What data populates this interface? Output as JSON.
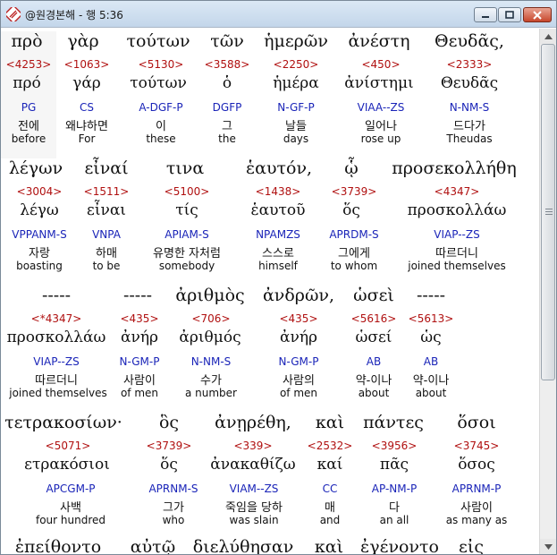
{
  "window": {
    "title": "@원경본해 - 행 5:36"
  },
  "verse": [
    {
      "greek": "πρὸ",
      "strong": "<4253>",
      "lemma": "πρό",
      "morph": "PG",
      "korean": "전에",
      "english": "before"
    },
    {
      "greek": "γὰρ",
      "strong": "<1063>",
      "lemma": "γάρ",
      "morph": "CS",
      "korean": "왜냐하면",
      "english": "For"
    },
    {
      "greek": "τούτων",
      "strong": "<5130>",
      "lemma": "τούτων",
      "morph": "A-DGF-P",
      "korean": "이",
      "english": "these"
    },
    {
      "greek": "τῶν",
      "strong": "<3588>",
      "lemma": "ὁ",
      "morph": "DGFP",
      "korean": "그",
      "english": "the"
    },
    {
      "greek": "ἡμερῶν",
      "strong": "<2250>",
      "lemma": "ἡμέρα",
      "morph": "N-GF-P",
      "korean": "날들",
      "english": "days"
    },
    {
      "greek": "ἀνέστη",
      "strong": "<450>",
      "lemma": "ἀνίστημι",
      "morph": "VIAA--ZS",
      "korean": "일어나",
      "english": "rose up"
    },
    {
      "greek": "Θευδᾶς,",
      "strong": "<2333>",
      "lemma": "Θευδᾶς",
      "morph": "N-NM-S",
      "korean": "드다가",
      "english": "Theudas"
    },
    {
      "greek": "λέγων",
      "strong": "<3004>",
      "lemma": "λέγω",
      "morph": "VPPANM-S",
      "korean": "자랑",
      "english": "boasting"
    },
    {
      "greek": "εἶναί",
      "strong": "<1511>",
      "lemma": "εἶναι",
      "morph": "VNPA",
      "korean": "하매",
      "english": "to be"
    },
    {
      "greek": "τινα",
      "strong": "<5100>",
      "lemma": "τίς",
      "morph": "APIAM-S",
      "korean": "유명한 자처럼",
      "english": "somebody"
    },
    {
      "greek": "ἑαυτόν,",
      "strong": "<1438>",
      "lemma": "ἑαυτοῦ",
      "morph": "NPAMZS",
      "korean": "스스로",
      "english": "himself"
    },
    {
      "greek": "ᾧ",
      "strong": "<3739>",
      "lemma": "ὅς",
      "morph": "APRDM-S",
      "korean": "그에게",
      "english": "to whom"
    },
    {
      "greek": "προσεκολλήθη",
      "strong": "<4347>",
      "lemma": "προσκολλάω",
      "morph": "VIAP--ZS",
      "korean": "따르더니",
      "english": "joined themselves"
    },
    {
      "greek": "-----",
      "strong": "<*4347>",
      "lemma": "προσκολλάω",
      "morph": "VIAP--ZS",
      "korean": "따르더니",
      "english": "joined themselves"
    },
    {
      "greek": "-----",
      "strong": "<435>",
      "lemma": "ἀνήρ",
      "morph": "N-GM-P",
      "korean": "사람이",
      "english": "of men"
    },
    {
      "greek": "ἀριθμὸς",
      "strong": "<706>",
      "lemma": "ἀριθμός",
      "morph": "N-NM-S",
      "korean": "수가",
      "english": "a number"
    },
    {
      "greek": "ἀνδρῶν,",
      "strong": "<435>",
      "lemma": "ἀνήρ",
      "morph": "N-GM-P",
      "korean": "사람의",
      "english": "of men"
    },
    {
      "greek": "ὡσεὶ",
      "strong": "<5616>",
      "lemma": "ὡσεί",
      "morph": "AB",
      "korean": "약-이나",
      "english": "about"
    },
    {
      "greek": "-----",
      "strong": "<5613>",
      "lemma": "ὡς",
      "morph": "AB",
      "korean": "약-이나",
      "english": "about"
    },
    {
      "greek": "τετρακοσίων·",
      "strong": "<5071>",
      "lemma": "ετρακόσιοι",
      "morph": "APCGM-P",
      "korean": "사백",
      "english": "four hundred"
    },
    {
      "greek": "ὃς",
      "strong": "<3739>",
      "lemma": "ὅς",
      "morph": "APRNM-S",
      "korean": "그가",
      "english": "who"
    },
    {
      "greek": "ἀνῃρέθη,",
      "strong": "<339>",
      "lemma": "ἀνακαθίζω",
      "morph": "VIAM--ZS",
      "korean": "죽임을 당하",
      "english": "was slain"
    },
    {
      "greek": "καὶ",
      "strong": "<2532>",
      "lemma": "καί",
      "morph": "CC",
      "korean": "매",
      "english": "and"
    },
    {
      "greek": "πάντες",
      "strong": "<3956>",
      "lemma": "πᾶς",
      "morph": "AP-NM-P",
      "korean": "다",
      "english": "an all"
    },
    {
      "greek": "ὅσοι",
      "strong": "<3745>",
      "lemma": "ὅσος",
      "morph": "APRNM-P",
      "korean": "사람이",
      "english": "as many as"
    },
    {
      "greek": "ἐπείθοντο"
    },
    {
      "greek": "αὐτῷ"
    },
    {
      "greek": "διελύθησαν"
    },
    {
      "greek": "καὶ"
    },
    {
      "greek": "ἐγένοντο"
    },
    {
      "greek": "εἰς"
    }
  ]
}
